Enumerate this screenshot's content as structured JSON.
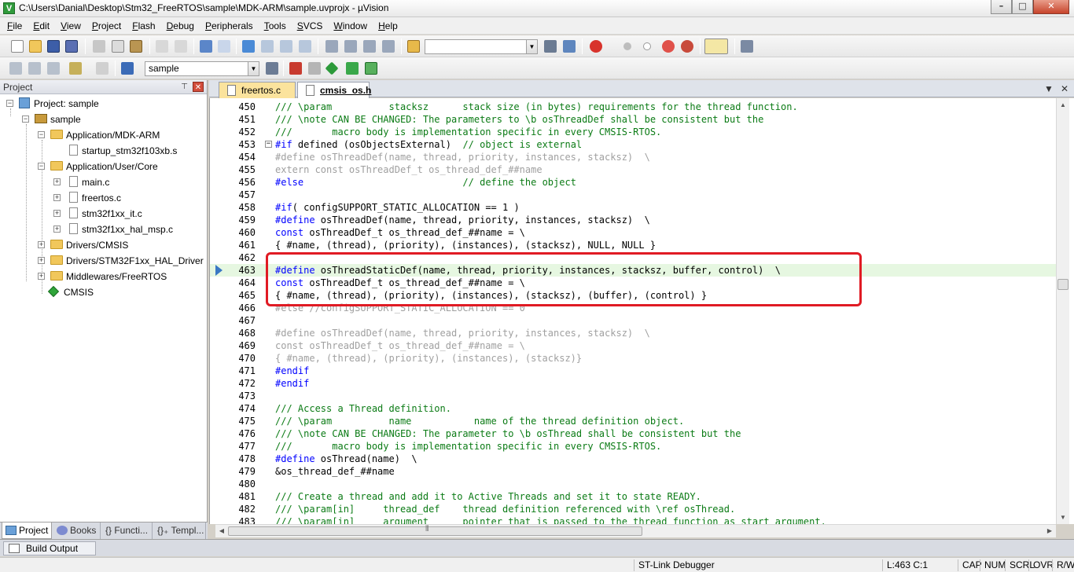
{
  "window": {
    "title": "C:\\Users\\Danial\\Desktop\\Stm32_FreeRTOS\\sample\\MDK-ARM\\sample.uvprojx - µVision",
    "app_icon_letter": "V",
    "minimize": "–",
    "maximize": "□",
    "close": "✕"
  },
  "menu": [
    {
      "u": "F",
      "rest": "ile"
    },
    {
      "u": "E",
      "rest": "dit"
    },
    {
      "u": "V",
      "rest": "iew"
    },
    {
      "u": "P",
      "rest": "roject"
    },
    {
      "u": "F",
      "rest": "lash"
    },
    {
      "u": "D",
      "rest": "ebug"
    },
    {
      "u": "P",
      "rest": "eripherals"
    },
    {
      "u": "T",
      "rest": "ools"
    },
    {
      "u": "S",
      "rest": "VCS"
    },
    {
      "u": "W",
      "rest": "indow"
    },
    {
      "u": "H",
      "rest": "elp"
    }
  ],
  "toolbar": {
    "find_combo_value": "",
    "target_combo_value": "sample",
    "dropdown_arrow": "▼"
  },
  "project_pane": {
    "header": "Project",
    "pin": "⊤",
    "close": "✕",
    "tree": {
      "root": "Project: sample",
      "target": "sample",
      "groups": [
        {
          "label": "Application/MDK-ARM",
          "files": [
            "startup_stm32f103xb.s"
          ]
        },
        {
          "label": "Application/User/Core",
          "files": [
            "main.c",
            "freertos.c",
            "stm32f1xx_it.c",
            "stm32f1xx_hal_msp.c"
          ]
        },
        {
          "label": "Drivers/CMSIS"
        },
        {
          "label": "Drivers/STM32F1xx_HAL_Driver"
        },
        {
          "label": "Middlewares/FreeRTOS"
        },
        {
          "label": "CMSIS"
        }
      ]
    },
    "tabs": [
      "Project",
      "Books",
      "{} Functi...",
      "{}₊ Templ..."
    ]
  },
  "editor": {
    "tabs": [
      {
        "label": "freertos.c",
        "active": false
      },
      {
        "label": "cmsis_os.h",
        "active": true
      }
    ],
    "tab_menu": "▼",
    "tab_close": "✕",
    "current_line": "463",
    "lines": [
      {
        "n": "450",
        "text": "/// \\param          stacksz      stack size (in bytes) requirements for the thread function.",
        "cls": "c-comment"
      },
      {
        "n": "451",
        "text": "/// \\note CAN BE CHANGED: The parameters to \\b osThreadDef shall be consistent but the",
        "cls": "c-comment"
      },
      {
        "n": "452",
        "text": "///       macro body is implementation specific in every CMSIS-RTOS.",
        "cls": "c-comment"
      },
      {
        "n": "453",
        "text": "#if defined (osObjectsExternal)  // object is external",
        "cls": "mix-if"
      },
      {
        "n": "454",
        "text": "#define osThreadDef(name, thread, priority, instances, stacksz)  \\",
        "cls": "c-dim"
      },
      {
        "n": "455",
        "text": "extern const osThreadDef_t os_thread_def_##name",
        "cls": "c-dim"
      },
      {
        "n": "456",
        "text": "#else                            // define the object",
        "cls": "mix-else"
      },
      {
        "n": "457",
        "text": "",
        "cls": ""
      },
      {
        "n": "458",
        "text": "#if( configSUPPORT_STATIC_ALLOCATION == 1 )",
        "cls": "mix-if2"
      },
      {
        "n": "459",
        "text": "#define osThreadDef(name, thread, priority, instances, stacksz)  \\",
        "cls": "mix-def"
      },
      {
        "n": "460",
        "text": "const osThreadDef_t os_thread_def_##name = \\",
        "cls": "mix-const"
      },
      {
        "n": "461",
        "text": "{ #name, (thread), (priority), (instances), (stacksz), NULL, NULL }",
        "cls": ""
      },
      {
        "n": "462",
        "text": "",
        "cls": ""
      },
      {
        "n": "463",
        "text": "#define osThreadStaticDef(name, thread, priority, instances, stacksz, buffer, control)  \\",
        "cls": "mix-def"
      },
      {
        "n": "464",
        "text": "const osThreadDef_t os_thread_def_##name = \\",
        "cls": "mix-const"
      },
      {
        "n": "465",
        "text": "{ #name, (thread), (priority), (instances), (stacksz), (buffer), (control) }",
        "cls": ""
      },
      {
        "n": "466",
        "text": "#else //configSUPPORT_STATIC_ALLOCATION == 0",
        "cls": "c-dim"
      },
      {
        "n": "467",
        "text": "",
        "cls": ""
      },
      {
        "n": "468",
        "text": "#define osThreadDef(name, thread, priority, instances, stacksz)  \\",
        "cls": "c-dim"
      },
      {
        "n": "469",
        "text": "const osThreadDef_t os_thread_def_##name = \\",
        "cls": "c-dim"
      },
      {
        "n": "470",
        "text": "{ #name, (thread), (priority), (instances), (stacksz)}",
        "cls": "c-dim"
      },
      {
        "n": "471",
        "text": "#endif",
        "cls": "c-dir"
      },
      {
        "n": "472",
        "text": "#endif",
        "cls": "c-dir"
      },
      {
        "n": "473",
        "text": "",
        "cls": ""
      },
      {
        "n": "474",
        "text": "/// Access a Thread definition.",
        "cls": "c-comment"
      },
      {
        "n": "475",
        "text": "/// \\param          name           name of the thread definition object.",
        "cls": "c-comment"
      },
      {
        "n": "476",
        "text": "/// \\note CAN BE CHANGED: The parameter to \\b osThread shall be consistent but the",
        "cls": "c-comment"
      },
      {
        "n": "477",
        "text": "///       macro body is implementation specific in every CMSIS-RTOS.",
        "cls": "c-comment"
      },
      {
        "n": "478",
        "text": "#define osThread(name)  \\",
        "cls": "mix-def"
      },
      {
        "n": "479",
        "text": "&os_thread_def_##name",
        "cls": ""
      },
      {
        "n": "480",
        "text": "",
        "cls": ""
      },
      {
        "n": "481",
        "text": "/// Create a thread and add it to Active Threads and set it to state READY.",
        "cls": "c-comment"
      },
      {
        "n": "482",
        "text": "/// \\param[in]     thread_def    thread definition referenced with \\ref osThread.",
        "cls": "c-comment"
      },
      {
        "n": "483",
        "text": "/// \\param[in]     argument      pointer that is passed to the thread function as start argument.",
        "cls": "c-comment"
      }
    ]
  },
  "scroll": {
    "up": "▲",
    "down": "▼",
    "left": "◀",
    "right": "▶",
    "grip": "⦀"
  },
  "build_output": {
    "label": "Build Output"
  },
  "status": {
    "debugger": "ST-Link Debugger",
    "position": "L:463 C:1",
    "caps": "CAP",
    "num": "NUM",
    "scrl": "SCRL",
    "ovr": "OVR",
    "rw": "R/W"
  },
  "colors": {
    "highlight_box": "#e01b24",
    "current_line_bg": "#e6f7e1",
    "comment": "#0b7b15",
    "keyword": "#0000ff"
  }
}
